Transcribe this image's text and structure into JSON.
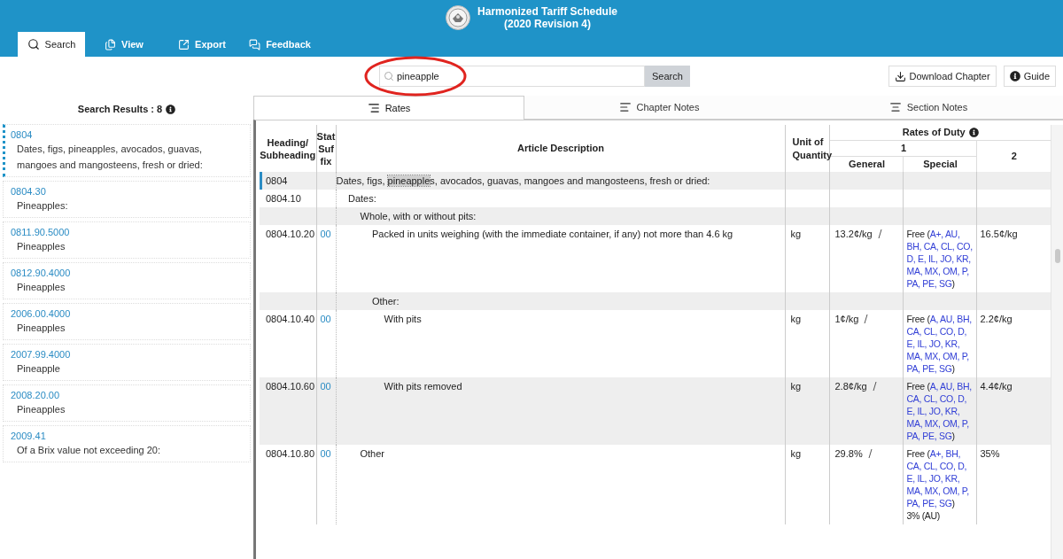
{
  "header": {
    "title_lines": [
      "Harmonized Tariff Schedule",
      "(2020 Revision 4)"
    ]
  },
  "nav_tabs": [
    {
      "label": "Search",
      "kind": "search",
      "selected": true
    },
    {
      "label": "View",
      "kind": "view",
      "selected": false
    },
    {
      "label": "Export",
      "kind": "export",
      "selected": false
    },
    {
      "label": "Feedback",
      "kind": "feedback",
      "selected": false
    }
  ],
  "search": {
    "value": "pineapple",
    "button": "Search"
  },
  "actions": [
    {
      "label": "Download Chapter",
      "kind": "download"
    },
    {
      "label": "Guide",
      "kind": "info"
    }
  ],
  "results": {
    "heading": "Search Results : 8",
    "items": [
      {
        "code": "0804",
        "description": "Dates, figs, pineapples, avocados, guavas, mangoes and mangosteens, fresh or dried:",
        "selected": true
      },
      {
        "code": "0804.30",
        "description": "Pineapples:",
        "selected": false
      },
      {
        "code": "0811.90.5000",
        "description": "Pineapples",
        "selected": false
      },
      {
        "code": "0812.90.4000",
        "description": "Pineapples",
        "selected": false
      },
      {
        "code": "2006.00.4000",
        "description": "Pineapples",
        "selected": false
      },
      {
        "code": "2007.99.4000",
        "description": "Pineapple",
        "selected": false
      },
      {
        "code": "2008.20.00",
        "description": "Pineapples",
        "selected": false
      },
      {
        "code": "2009.41",
        "description": "Of a Brix value not exceeding 20:",
        "selected": false
      }
    ]
  },
  "content_tabs": [
    {
      "label": "Rates",
      "kind": "rates",
      "selected": true
    },
    {
      "label": "Chapter Notes",
      "kind": "chapter",
      "selected": false
    },
    {
      "label": "Section Notes",
      "kind": "section",
      "selected": false
    }
  ],
  "table": {
    "columns": {
      "heading": "Heading/ Subheading",
      "stat": "Stat Suf fix",
      "description": "Article Description",
      "unit": "Unit of Quantity",
      "rates": "Rates of Duty",
      "rate_1": "1",
      "general": "General",
      "special": "Special",
      "rate_2": "2"
    },
    "rows": [
      {
        "heading": "0804",
        "selected": true,
        "description": [
          {
            "text": "Dates, figs, ",
            "highlighted": false
          },
          {
            "text": "pineapple",
            "highlighted": true
          },
          {
            "text": "s, avocados, guavas, mangoes and mangosteens, fresh or dried:",
            "highlighted": false
          }
        ],
        "children": [
          {
            "heading": "0804.10",
            "selected": false,
            "description": "Dates:",
            "children": [
              {
                "selected": false,
                "description": "Whole, with or without pits:",
                "children": [
                  {
                    "heading": "0804.10.20",
                    "stat": "00",
                    "selected": false,
                    "description": "Packed in units weighing (with the immediate container, if any) not more than 4.6 kg",
                    "unit": "kg",
                    "general": "13.2¢/kg",
                    "special": {
                      "prefix": "Free (",
                      "programs": "A+, AU, BH, CA, CL, CO, D, E, IL, JO, KR, MA, MX, OM, P, PA, PE, SG",
                      "suffix": ")"
                    },
                    "rate_2": "16.5¢/kg"
                  },
                  {
                    "selected": false,
                    "description": "Other:",
                    "children": [
                      {
                        "heading": "0804.10.40",
                        "stat": "00",
                        "selected": false,
                        "description": "With pits",
                        "unit": "kg",
                        "general": "1¢/kg",
                        "special": {
                          "prefix": "Free (",
                          "programs": "A, AU, BH, CA, CL, CO, D, E, IL, JO, KR, MA, MX, OM, P, PA, PE, SG",
                          "suffix": ")"
                        },
                        "rate_2": "2.2¢/kg"
                      },
                      {
                        "heading": "0804.10.60",
                        "stat": "00",
                        "selected": false,
                        "description": "With pits removed",
                        "unit": "kg",
                        "general": "2.8¢/kg",
                        "special": {
                          "prefix": "Free (",
                          "programs": "A, AU, BH, CA, CL, CO, D, E, IL, JO, KR, MA, MX, OM, P, PA, PE, SG",
                          "suffix": ")"
                        },
                        "rate_2": "4.4¢/kg"
                      }
                    ]
                  }
                ]
              },
              {
                "heading": "0804.10.80",
                "stat": "00",
                "selected": false,
                "description": "Other",
                "unit": "kg",
                "general": "29.8%",
                "special": {
                  "prefix": "Free (",
                  "programs": "A+, BH, CA, CL, CO, D, E, IL, JO, KR, MA, MX, OM, P, PA, PE, SG",
                  "suffix": ")",
                  "extra": "3% (AU)"
                },
                "rate_2": "35%"
              }
            ]
          }
        ]
      }
    ]
  }
}
